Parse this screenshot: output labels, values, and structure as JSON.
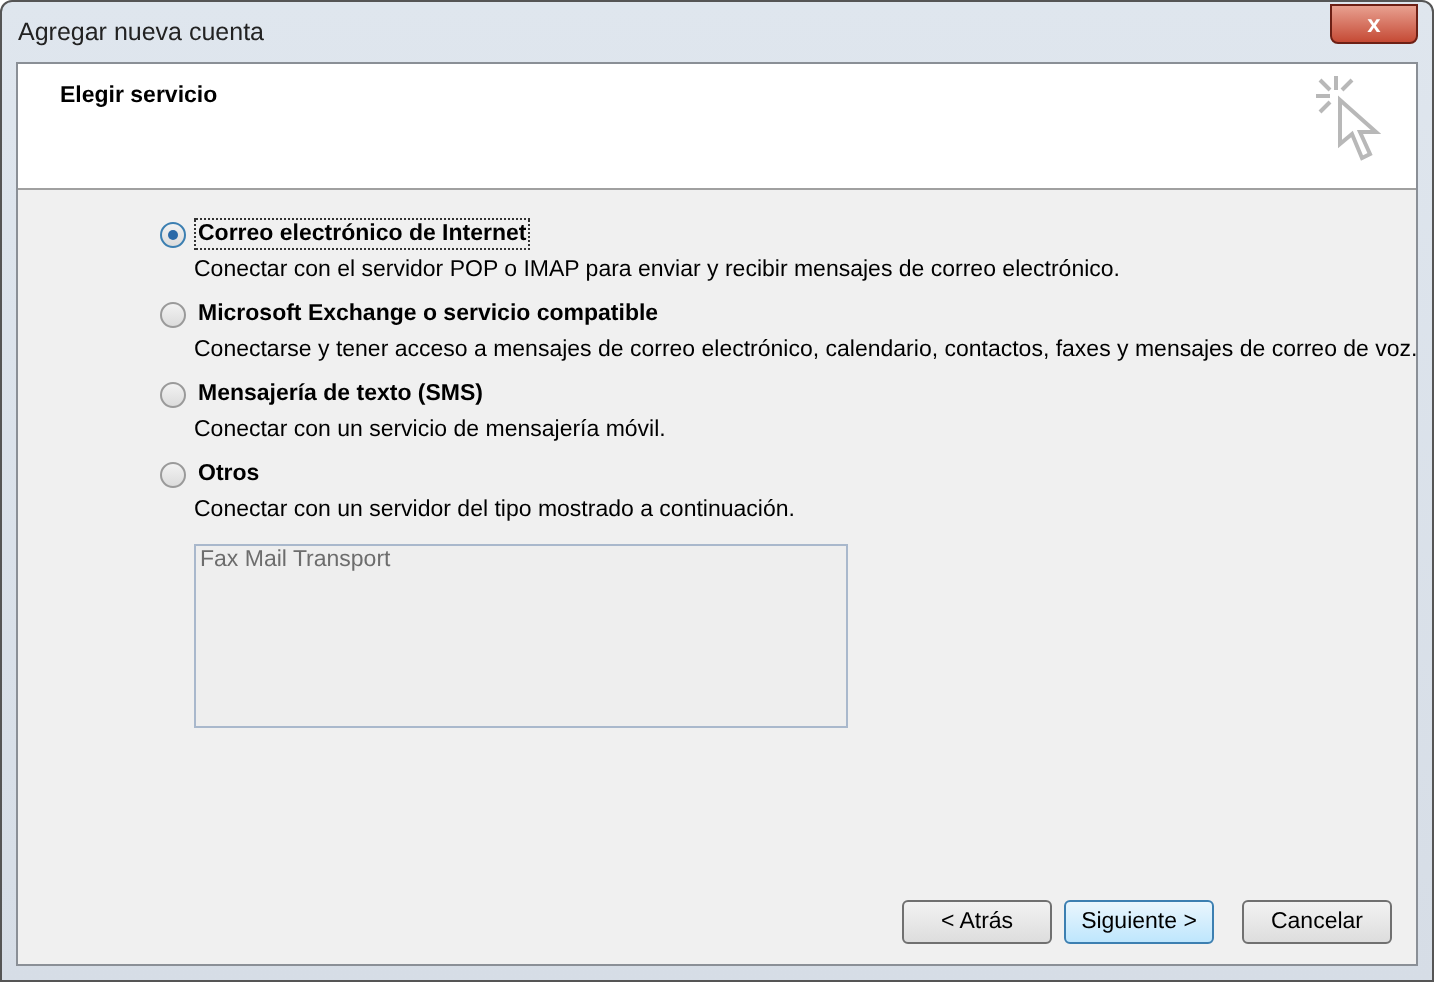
{
  "window": {
    "title": "Agregar nueva cuenta",
    "close_label": "x"
  },
  "header": {
    "title": "Elegir servicio"
  },
  "options": [
    {
      "label": "Correo electrónico de Internet",
      "description": "Conectar con el servidor POP o IMAP para enviar y recibir mensajes de correo electrónico.",
      "selected": true
    },
    {
      "label": "Microsoft Exchange o servicio compatible",
      "description": "Conectarse y tener acceso a mensajes de correo electrónico, calendario, contactos, faxes y mensajes de correo de voz.",
      "selected": false
    },
    {
      "label": "Mensajería de texto (SMS)",
      "description": "Conectar con un servicio de mensajería móvil.",
      "selected": false
    },
    {
      "label": "Otros",
      "description": "Conectar con un servidor del tipo mostrado a continuación.",
      "selected": false
    }
  ],
  "other_list": {
    "disabled": true,
    "items": [
      "Fax Mail Transport"
    ]
  },
  "buttons": [
    {
      "label": "< Atrás",
      "default": false
    },
    {
      "label": "Siguiente >",
      "default": true
    },
    {
      "label": "Cancelar",
      "default": false
    }
  ]
}
